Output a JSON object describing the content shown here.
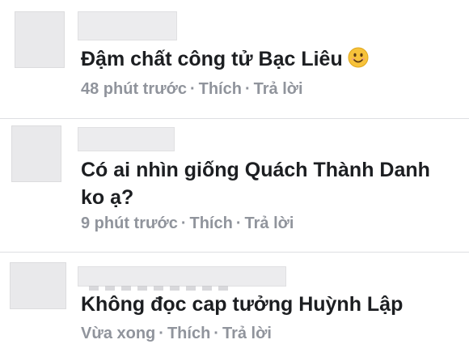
{
  "comments": [
    {
      "text": "Đậm chất công tử Bạc Liêu",
      "emoji": "smiling-face-icon",
      "time": "48 phút trước",
      "like_label": "Thích",
      "reply_label": "Trả lời"
    },
    {
      "text_line1": "Có ai nhìn giống Quách Thành Danh",
      "text_line2": "ko ạ?",
      "time": "9 phút trước",
      "like_label": "Thích",
      "reply_label": "Trả lời"
    },
    {
      "text": "Không đọc cap tưởng Huỳnh Lập",
      "time": "Vừa xong",
      "like_label": "Thích",
      "reply_label": "Trả lời"
    }
  ],
  "separator": "·",
  "colors": {
    "text": "#1c1e21",
    "meta": "#90949c",
    "divider": "#dddfe2",
    "emoji": "#f7c23a"
  }
}
